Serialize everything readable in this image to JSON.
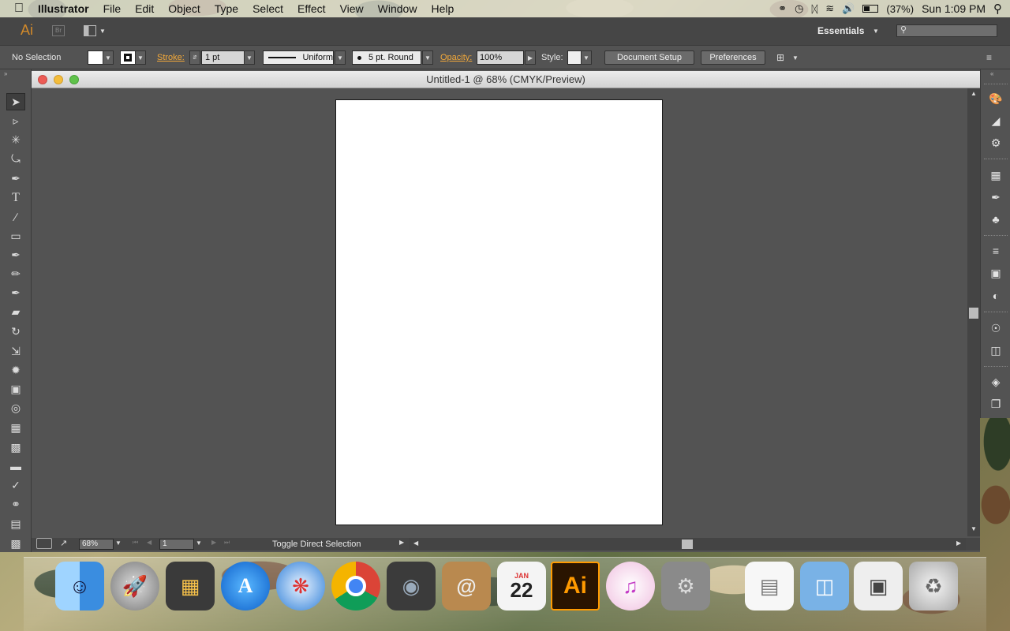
{
  "menubar": {
    "apple": "",
    "app_name": "Illustrator",
    "menus": [
      "File",
      "Edit",
      "Object",
      "Type",
      "Select",
      "Effect",
      "View",
      "Window",
      "Help"
    ],
    "battery": "(37%)",
    "clock": "Sun 1:09 PM"
  },
  "appbar": {
    "logo": "Ai",
    "bridge": "Br",
    "workspace": "Essentials"
  },
  "control": {
    "selection": "No Selection",
    "stroke_label": "Stroke:",
    "stroke_weight": "1 pt",
    "profile": "Uniform",
    "brush": "5 pt. Round",
    "opacity_label": "Opacity:",
    "opacity": "100%",
    "style_label": "Style:",
    "document_setup": "Document Setup",
    "preferences": "Preferences"
  },
  "document": {
    "title": "Untitled-1 @ 68% (CMYK/Preview)"
  },
  "status": {
    "zoom": "68%",
    "artboard": "1",
    "message": "Toggle Direct Selection"
  },
  "dock": {
    "calendar_month": "JAN",
    "calendar_day": "22",
    "ai_label": "Ai"
  },
  "colors": {
    "accent_orange": "#f3a93a",
    "ai_brand": "#ff9a00",
    "panel": "#535353"
  }
}
